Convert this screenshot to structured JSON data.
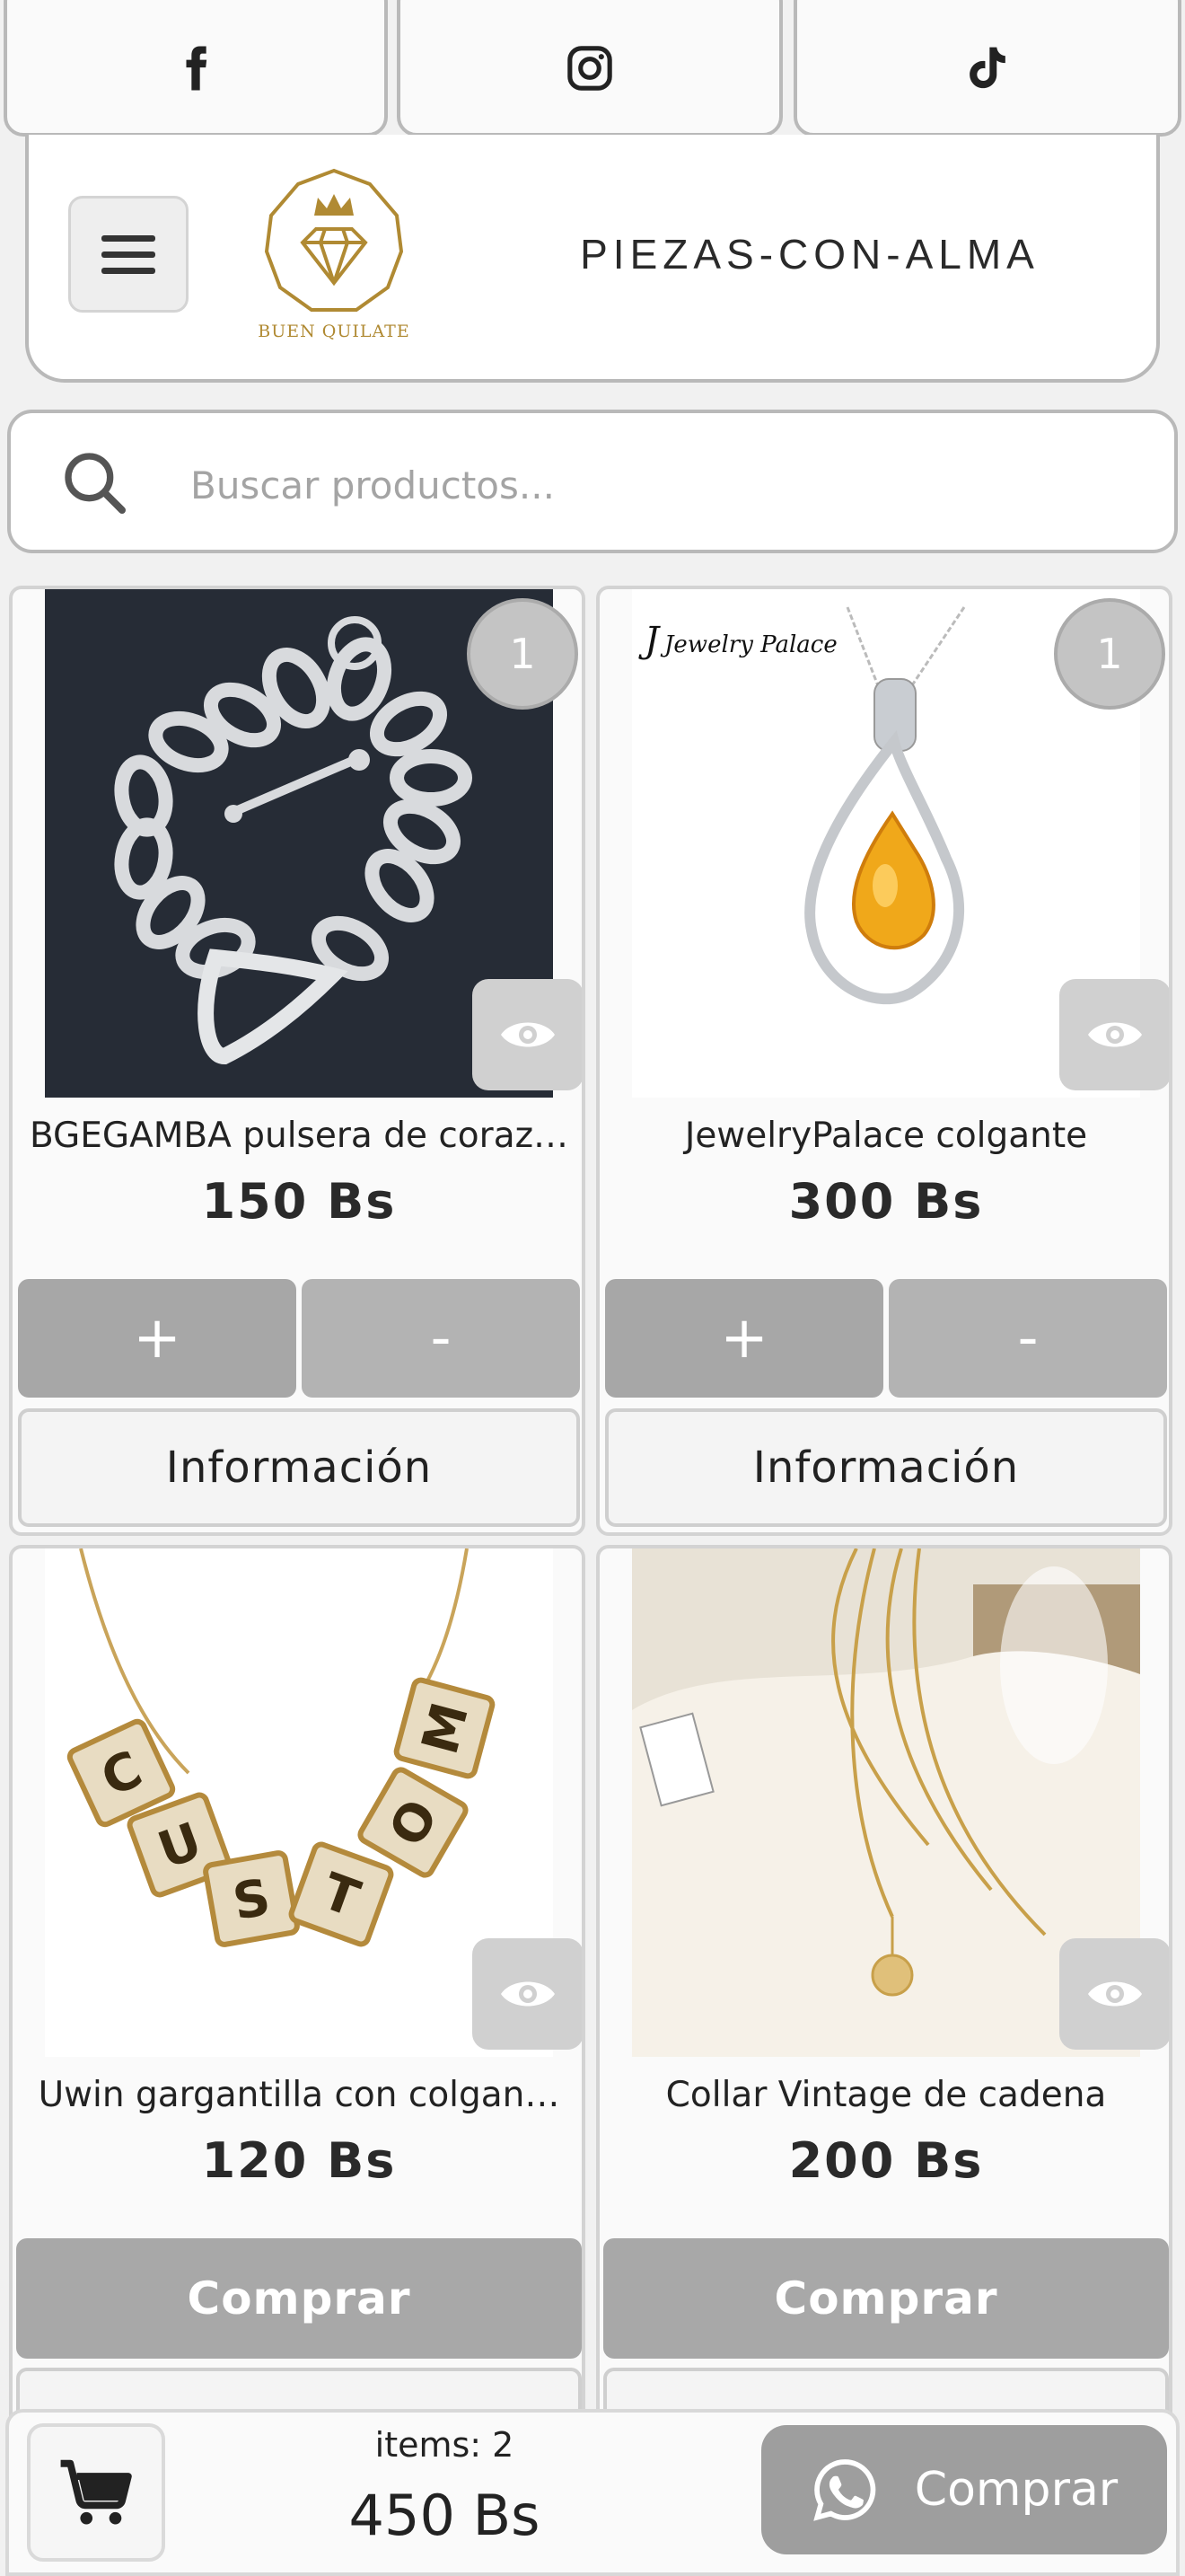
{
  "social": {
    "buttons": [
      {
        "name": "facebook",
        "icon": "facebook-icon"
      },
      {
        "name": "instagram",
        "icon": "instagram-icon"
      },
      {
        "name": "tiktok",
        "icon": "tiktok-icon"
      }
    ]
  },
  "header": {
    "menu_icon": "hamburger-menu-icon",
    "logo_text": "BUEN QUILATE",
    "shop_name": "PIEZAS-CON-ALMA",
    "brand_color": "#b08a33"
  },
  "search": {
    "placeholder": "Buscar productos...",
    "value": "",
    "icon": "search-icon"
  },
  "products": [
    {
      "name": "BGEGAMBA pulsera de coraz…",
      "price": "150 Bs",
      "quantity": "1",
      "plus_label": "+",
      "minus_label": "-",
      "info_label": "Información"
    },
    {
      "name": "JewelryPalace colgante",
      "price": "300 Bs",
      "quantity": "1",
      "image_watermark": "Jewelry Palace",
      "plus_label": "+",
      "minus_label": "-",
      "info_label": "Información"
    },
    {
      "name": "Uwin gargantilla con colgan…",
      "price": "120 Bs",
      "image_text": "CUSTOM",
      "buy_label": "Comprar"
    },
    {
      "name": "Collar Vintage de cadena",
      "price": "200 Bs",
      "buy_label": "Comprar"
    }
  ],
  "cart": {
    "items_label": "items: 2",
    "total": "450 Bs",
    "buy_label": "Comprar",
    "cart_icon": "shopping-cart-icon",
    "whatsapp_icon": "whatsapp-icon"
  },
  "colors": {
    "button_gray": "#a7a7a7",
    "border_gray": "#b9b9b9",
    "background": "#f1f1f1"
  }
}
